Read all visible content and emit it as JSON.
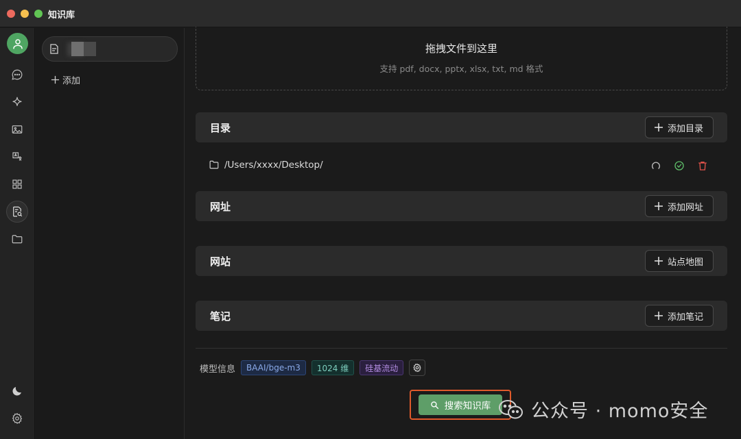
{
  "window": {
    "title": "知识库"
  },
  "sidebar": {
    "icons": [
      "avatar-icon",
      "chat-icon",
      "sparkle-icon",
      "image-icon",
      "translate-icon",
      "apps-icon",
      "knowledge-icon",
      "folder-icon",
      "moon-icon",
      "gear-icon"
    ]
  },
  "kb_list": {
    "add_label": "添加"
  },
  "dropzone": {
    "title": "拖拽文件到这里",
    "subtitle": "支持 pdf, docx, pptx, xlsx, txt, md 格式"
  },
  "sections": {
    "directory": {
      "title": "目录",
      "button": "添加目录"
    },
    "url": {
      "title": "网址",
      "button": "添加网址"
    },
    "website": {
      "title": "网站",
      "button": "站点地图"
    },
    "notes": {
      "title": "笔记",
      "button": "添加笔记"
    }
  },
  "directory_items": [
    {
      "path": "/Users/xxxx/Desktop/"
    }
  ],
  "model_info": {
    "label": "模型信息",
    "model": "BAAI/bge-m3",
    "dimensions": "1024 维",
    "provider": "硅基流动"
  },
  "search": {
    "label": "搜索知识库"
  },
  "watermark": {
    "text": "公众号 · momo安全"
  },
  "colors": {
    "accent_green": "#5e9e68",
    "highlight_border": "#e05a2b",
    "delete_red": "#e0524a",
    "check_green": "#5fbf6a"
  }
}
